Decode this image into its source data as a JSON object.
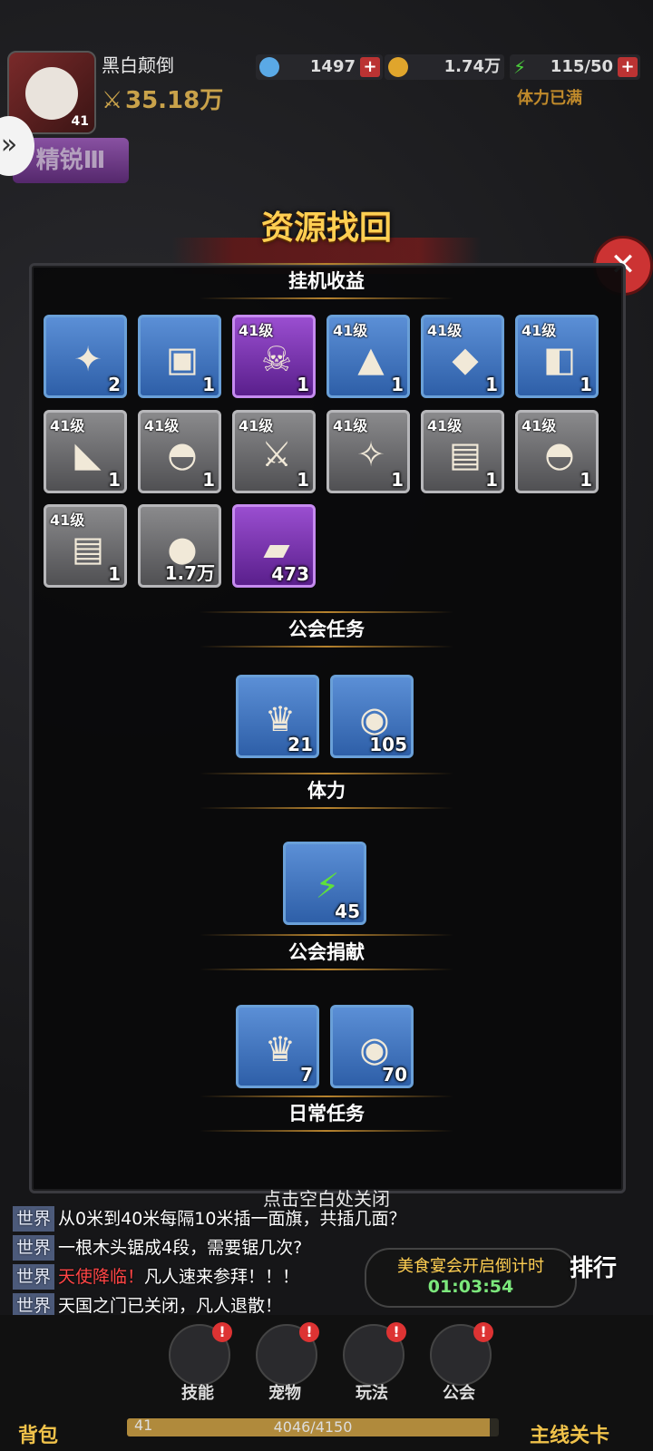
{
  "player": {
    "name": "黑白颠倒",
    "level": "41",
    "power": "35.18万"
  },
  "resources": {
    "gems": "1497",
    "gold": "1.74万",
    "stamina": "115/50",
    "stamina_note": "体力已满"
  },
  "rank_badge": "精锐Ⅲ",
  "dialog": {
    "title": "资源找回",
    "hint": "点击空白处关闭",
    "sections": [
      {
        "title": "挂机收益",
        "items": [
          {
            "level": "",
            "count": "2",
            "tier": "blue",
            "icon": "blueprint-scroll-icon"
          },
          {
            "level": "",
            "count": "1",
            "tier": "blue",
            "icon": "chest-scroll-icon"
          },
          {
            "level": "41级",
            "count": "1",
            "tier": "purple",
            "icon": "horned-helmet-icon"
          },
          {
            "level": "41级",
            "count": "1",
            "tier": "blue",
            "icon": "hood-icon"
          },
          {
            "level": "41级",
            "count": "1",
            "tier": "blue",
            "icon": "armor-icon"
          },
          {
            "level": "41级",
            "count": "1",
            "tier": "blue",
            "icon": "gauntlet-icon"
          },
          {
            "level": "41级",
            "count": "1",
            "tier": "gray",
            "icon": "boots-icon"
          },
          {
            "level": "41级",
            "count": "1",
            "tier": "gray",
            "icon": "hat-icon"
          },
          {
            "level": "41级",
            "count": "1",
            "tier": "gray",
            "icon": "sword-icon"
          },
          {
            "level": "41级",
            "count": "1",
            "tier": "gray",
            "icon": "collar-icon"
          },
          {
            "level": "41级",
            "count": "1",
            "tier": "gray",
            "icon": "bracer-icon"
          },
          {
            "level": "41级",
            "count": "1",
            "tier": "gray",
            "icon": "hat-icon"
          },
          {
            "level": "41级",
            "count": "1",
            "tier": "gray",
            "icon": "bracer-icon"
          },
          {
            "level": "",
            "count": "1.7万",
            "tier": "gray",
            "icon": "silver-coin-icon"
          },
          {
            "level": "",
            "count": "473",
            "tier": "purple",
            "icon": "exp-book-icon"
          }
        ]
      },
      {
        "title": "公会任务",
        "items": [
          {
            "level": "",
            "count": "21",
            "tier": "blue",
            "icon": "guild-badge-icon"
          },
          {
            "level": "",
            "count": "105",
            "tier": "blue",
            "icon": "guild-coin-icon"
          }
        ]
      },
      {
        "title": "体力",
        "items": [
          {
            "level": "",
            "count": "45",
            "tier": "blue",
            "icon": "lightning-icon"
          }
        ]
      },
      {
        "title": "公会捐献",
        "items": [
          {
            "level": "",
            "count": "7",
            "tier": "blue",
            "icon": "guild-badge-icon"
          },
          {
            "level": "",
            "count": "70",
            "tier": "blue",
            "icon": "guild-coin-icon"
          }
        ]
      },
      {
        "title": "日常任务",
        "items": []
      }
    ]
  },
  "chat": [
    {
      "tag": "世界",
      "text": "从0米到40米每隔10米插一面旗，共插几面？"
    },
    {
      "tag": "世界",
      "text": "一根木头锯成4段，需要锯几次?"
    },
    {
      "tag": "世界",
      "highlight": "天使降临！",
      "text": "凡人速来参拜！！！"
    },
    {
      "tag": "世界",
      "text": "天国之门已关闭，凡人退散！"
    }
  ],
  "event": {
    "name": "美食宴会开启倒计时",
    "countdown": "01:03:54"
  },
  "rank_label": "排行",
  "nav": {
    "bag": "背包",
    "skill": "技能",
    "pet": "宠物",
    "play": "玩法",
    "guild": "公会",
    "main_stage": "主线关卡"
  },
  "xp": {
    "level": "41",
    "text": "4046/4150",
    "fraction": 0.975
  },
  "colors": {
    "accent": "#ffcf52",
    "badge": "#dd3333"
  }
}
